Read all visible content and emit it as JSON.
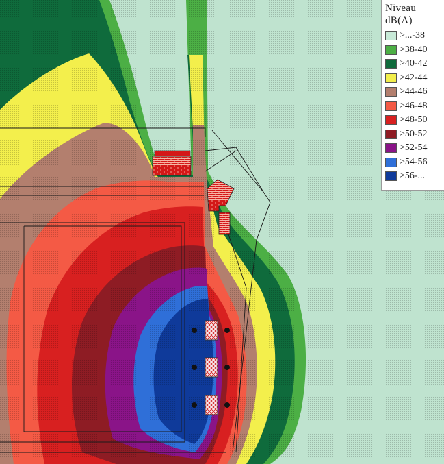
{
  "map": {
    "kind": "noise-contour-map",
    "background_color": "#bfe3cf",
    "layer_colors": [
      "#bfe3cf",
      "#4caf45",
      "#0f6b3c",
      "#f3ef4c",
      "#b37f6e",
      "#f45a45",
      "#d82020",
      "#8e1c24",
      "#8a1488",
      "#2f6fd8",
      "#0f3a9a"
    ],
    "sources": [
      "noise-source-1",
      "noise-source-2",
      "noise-source-3"
    ],
    "buildings": [
      "building-1",
      "building-2",
      "building-3"
    ]
  },
  "legend": {
    "title_line1": "Niveau",
    "title_line2": "dB(A)",
    "items": [
      {
        "label": ">...-38",
        "color": "#c8ead8"
      },
      {
        "label": ">38-40",
        "color": "#4caf45"
      },
      {
        "label": ">40-42",
        "color": "#0f6b3c"
      },
      {
        "label": ">42-44",
        "color": "#f3ef4c"
      },
      {
        "label": ">44-46",
        "color": "#b37f6e"
      },
      {
        "label": ">46-48",
        "color": "#f45a45"
      },
      {
        "label": ">48-50",
        "color": "#d82020"
      },
      {
        "label": ">50-52",
        "color": "#8e1c24"
      },
      {
        "label": ">52-54",
        "color": "#8a1488"
      },
      {
        "label": ">54-56",
        "color": "#2f6fd8"
      },
      {
        "label": ">56-...",
        "color": "#0f3a9a"
      }
    ]
  }
}
